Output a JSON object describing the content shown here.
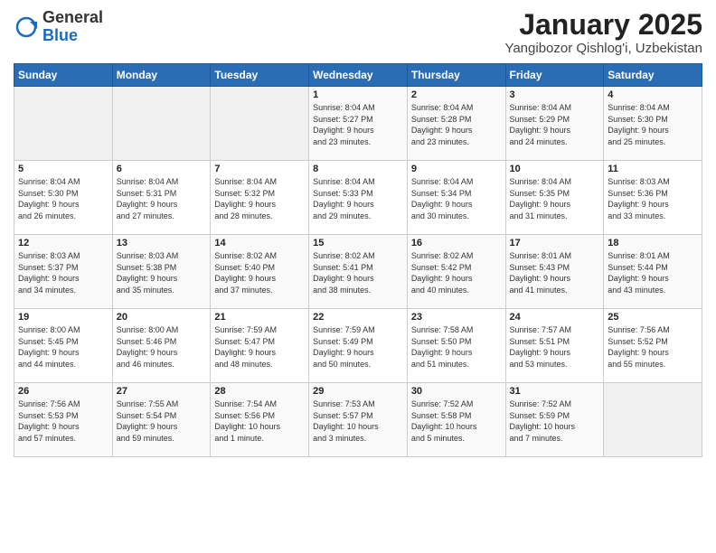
{
  "logo": {
    "general": "General",
    "blue": "Blue"
  },
  "header": {
    "title": "January 2025",
    "subtitle": "Yangibozor Qishlog'i, Uzbekistan"
  },
  "weekdays": [
    "Sunday",
    "Monday",
    "Tuesday",
    "Wednesday",
    "Thursday",
    "Friday",
    "Saturday"
  ],
  "weeks": [
    [
      {
        "day": "",
        "info": ""
      },
      {
        "day": "",
        "info": ""
      },
      {
        "day": "",
        "info": ""
      },
      {
        "day": "1",
        "info": "Sunrise: 8:04 AM\nSunset: 5:27 PM\nDaylight: 9 hours\nand 23 minutes."
      },
      {
        "day": "2",
        "info": "Sunrise: 8:04 AM\nSunset: 5:28 PM\nDaylight: 9 hours\nand 23 minutes."
      },
      {
        "day": "3",
        "info": "Sunrise: 8:04 AM\nSunset: 5:29 PM\nDaylight: 9 hours\nand 24 minutes."
      },
      {
        "day": "4",
        "info": "Sunrise: 8:04 AM\nSunset: 5:30 PM\nDaylight: 9 hours\nand 25 minutes."
      }
    ],
    [
      {
        "day": "5",
        "info": "Sunrise: 8:04 AM\nSunset: 5:30 PM\nDaylight: 9 hours\nand 26 minutes."
      },
      {
        "day": "6",
        "info": "Sunrise: 8:04 AM\nSunset: 5:31 PM\nDaylight: 9 hours\nand 27 minutes."
      },
      {
        "day": "7",
        "info": "Sunrise: 8:04 AM\nSunset: 5:32 PM\nDaylight: 9 hours\nand 28 minutes."
      },
      {
        "day": "8",
        "info": "Sunrise: 8:04 AM\nSunset: 5:33 PM\nDaylight: 9 hours\nand 29 minutes."
      },
      {
        "day": "9",
        "info": "Sunrise: 8:04 AM\nSunset: 5:34 PM\nDaylight: 9 hours\nand 30 minutes."
      },
      {
        "day": "10",
        "info": "Sunrise: 8:04 AM\nSunset: 5:35 PM\nDaylight: 9 hours\nand 31 minutes."
      },
      {
        "day": "11",
        "info": "Sunrise: 8:03 AM\nSunset: 5:36 PM\nDaylight: 9 hours\nand 33 minutes."
      }
    ],
    [
      {
        "day": "12",
        "info": "Sunrise: 8:03 AM\nSunset: 5:37 PM\nDaylight: 9 hours\nand 34 minutes."
      },
      {
        "day": "13",
        "info": "Sunrise: 8:03 AM\nSunset: 5:38 PM\nDaylight: 9 hours\nand 35 minutes."
      },
      {
        "day": "14",
        "info": "Sunrise: 8:02 AM\nSunset: 5:40 PM\nDaylight: 9 hours\nand 37 minutes."
      },
      {
        "day": "15",
        "info": "Sunrise: 8:02 AM\nSunset: 5:41 PM\nDaylight: 9 hours\nand 38 minutes."
      },
      {
        "day": "16",
        "info": "Sunrise: 8:02 AM\nSunset: 5:42 PM\nDaylight: 9 hours\nand 40 minutes."
      },
      {
        "day": "17",
        "info": "Sunrise: 8:01 AM\nSunset: 5:43 PM\nDaylight: 9 hours\nand 41 minutes."
      },
      {
        "day": "18",
        "info": "Sunrise: 8:01 AM\nSunset: 5:44 PM\nDaylight: 9 hours\nand 43 minutes."
      }
    ],
    [
      {
        "day": "19",
        "info": "Sunrise: 8:00 AM\nSunset: 5:45 PM\nDaylight: 9 hours\nand 44 minutes."
      },
      {
        "day": "20",
        "info": "Sunrise: 8:00 AM\nSunset: 5:46 PM\nDaylight: 9 hours\nand 46 minutes."
      },
      {
        "day": "21",
        "info": "Sunrise: 7:59 AM\nSunset: 5:47 PM\nDaylight: 9 hours\nand 48 minutes."
      },
      {
        "day": "22",
        "info": "Sunrise: 7:59 AM\nSunset: 5:49 PM\nDaylight: 9 hours\nand 50 minutes."
      },
      {
        "day": "23",
        "info": "Sunrise: 7:58 AM\nSunset: 5:50 PM\nDaylight: 9 hours\nand 51 minutes."
      },
      {
        "day": "24",
        "info": "Sunrise: 7:57 AM\nSunset: 5:51 PM\nDaylight: 9 hours\nand 53 minutes."
      },
      {
        "day": "25",
        "info": "Sunrise: 7:56 AM\nSunset: 5:52 PM\nDaylight: 9 hours\nand 55 minutes."
      }
    ],
    [
      {
        "day": "26",
        "info": "Sunrise: 7:56 AM\nSunset: 5:53 PM\nDaylight: 9 hours\nand 57 minutes."
      },
      {
        "day": "27",
        "info": "Sunrise: 7:55 AM\nSunset: 5:54 PM\nDaylight: 9 hours\nand 59 minutes."
      },
      {
        "day": "28",
        "info": "Sunrise: 7:54 AM\nSunset: 5:56 PM\nDaylight: 10 hours\nand 1 minute."
      },
      {
        "day": "29",
        "info": "Sunrise: 7:53 AM\nSunset: 5:57 PM\nDaylight: 10 hours\nand 3 minutes."
      },
      {
        "day": "30",
        "info": "Sunrise: 7:52 AM\nSunset: 5:58 PM\nDaylight: 10 hours\nand 5 minutes."
      },
      {
        "day": "31",
        "info": "Sunrise: 7:52 AM\nSunset: 5:59 PM\nDaylight: 10 hours\nand 7 minutes."
      },
      {
        "day": "",
        "info": ""
      }
    ]
  ]
}
